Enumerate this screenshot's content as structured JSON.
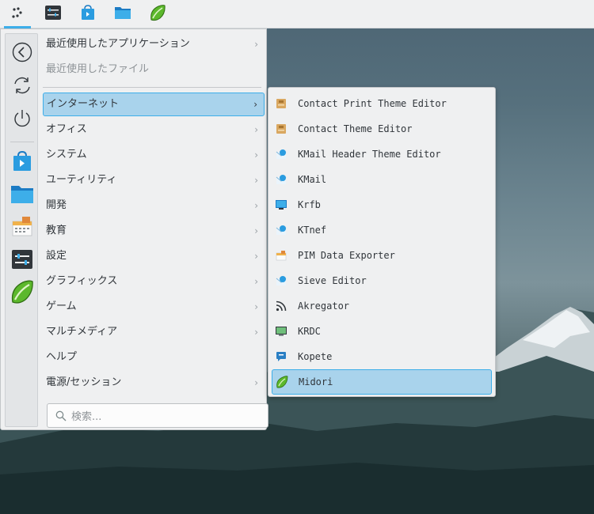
{
  "panel": {
    "buttons": [
      {
        "name": "launcher-icon"
      },
      {
        "name": "settings-app-icon"
      },
      {
        "name": "discover-icon"
      },
      {
        "name": "file-manager-icon"
      },
      {
        "name": "midori-icon"
      }
    ]
  },
  "favorites": [
    {
      "name": "back-icon"
    },
    {
      "name": "refresh-icon"
    },
    {
      "name": "power-icon"
    },
    {
      "name": "discover-icon"
    },
    {
      "name": "folder-icon"
    },
    {
      "name": "pim-icon"
    },
    {
      "name": "settings-app-icon"
    },
    {
      "name": "midori-icon"
    }
  ],
  "categories": [
    {
      "label": "最近使用したアプリケーション",
      "chevron": "›"
    },
    {
      "label": "最近使用したファイル"
    },
    {
      "label": "インターネット",
      "chevron": "›"
    },
    {
      "label": "オフィス",
      "chevron": "›"
    },
    {
      "label": "システム",
      "chevron": "›"
    },
    {
      "label": "ユーティリティ",
      "chevron": "›"
    },
    {
      "label": "開発",
      "chevron": "›"
    },
    {
      "label": "教育",
      "chevron": "›"
    },
    {
      "label": "設定",
      "chevron": "›"
    },
    {
      "label": "グラフィックス",
      "chevron": "›"
    },
    {
      "label": "ゲーム",
      "chevron": "›"
    },
    {
      "label": "マルチメディア",
      "chevron": "›"
    },
    {
      "label": "ヘルプ"
    },
    {
      "label": "電源/セッション",
      "chevron": "›"
    }
  ],
  "search": {
    "placeholder": "検索..."
  },
  "submenu": [
    {
      "label": "Contact Print Theme Editor",
      "icon": "contact-print-theme-icon"
    },
    {
      "label": "Contact Theme Editor",
      "icon": "contact-theme-icon"
    },
    {
      "label": "KMail Header Theme Editor",
      "icon": "kmail-header-theme-icon"
    },
    {
      "label": "KMail",
      "icon": "kmail-icon"
    },
    {
      "label": "Krfb",
      "icon": "krfb-icon"
    },
    {
      "label": "KTnef",
      "icon": "ktnef-icon"
    },
    {
      "label": "PIM Data Exporter",
      "icon": "pim-data-exporter-icon"
    },
    {
      "label": "Sieve Editor",
      "icon": "sieve-editor-icon"
    },
    {
      "label": "Akregator",
      "icon": "rss-icon"
    },
    {
      "label": "KRDC",
      "icon": "krdc-icon"
    },
    {
      "label": "Kopete",
      "icon": "kopete-icon"
    },
    {
      "label": "Midori",
      "icon": "midori-icon"
    }
  ],
  "colors": {
    "accent": "#3daee9",
    "selection": "#a9d3ec",
    "panel": "#eff0f1"
  }
}
